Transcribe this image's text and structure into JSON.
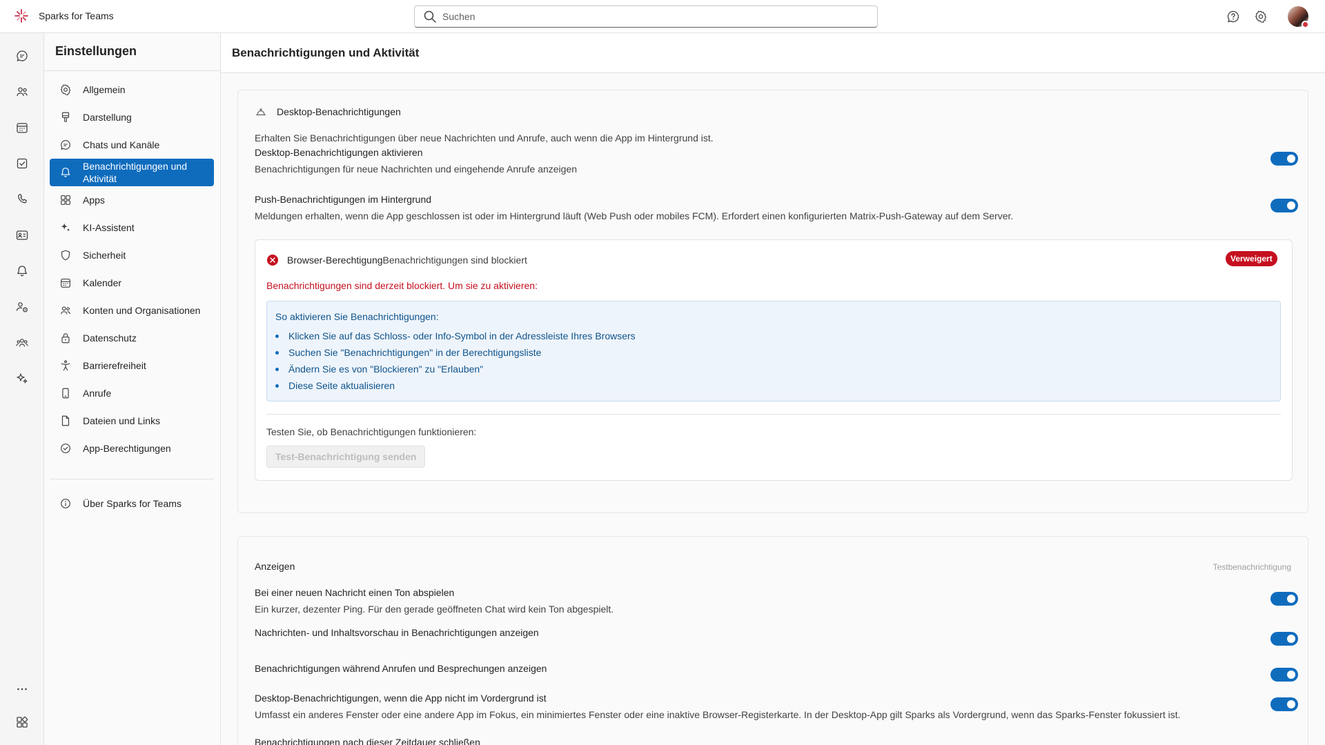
{
  "app": {
    "name": "Sparks for Teams"
  },
  "search": {
    "placeholder": "Suchen"
  },
  "colors": {
    "accent": "#0f6cbd",
    "error": "#c50f1f",
    "info_text": "#0f548c"
  },
  "topbar": {
    "icons": [
      "help-icon",
      "settings-icon",
      "avatar"
    ]
  },
  "rail": {
    "icons": [
      "chat-icon",
      "teams-icon",
      "calendar-icon",
      "tasks-icon",
      "calls-icon",
      "contacts-icon",
      "activity-icon",
      "people-icon",
      "communities-icon",
      "ai-icon",
      "more-icon",
      "apps-icon"
    ]
  },
  "sidebar": {
    "title": "Einstellungen",
    "items": [
      {
        "label": "Allgemein",
        "icon": "gear-icon"
      },
      {
        "label": "Darstellung",
        "icon": "paint-brush-icon"
      },
      {
        "label": "Chats und Kanäle",
        "icon": "chat-icon"
      },
      {
        "label": "Benachrichtigungen und Aktivität",
        "icon": "bell-icon"
      },
      {
        "label": "Apps",
        "icon": "apps-icon"
      },
      {
        "label": "KI-Assistent",
        "icon": "sparkle-icon"
      },
      {
        "label": "Sicherheit",
        "icon": "shield-icon"
      },
      {
        "label": "Kalender",
        "icon": "calendar-icon"
      },
      {
        "label": "Konten und Organisationen",
        "icon": "people-icon"
      },
      {
        "label": "Datenschutz",
        "icon": "lock-icon"
      },
      {
        "label": "Barrierefreiheit",
        "icon": "accessibility-icon"
      },
      {
        "label": "Anrufe",
        "icon": "phone-icon"
      },
      {
        "label": "Dateien und Links",
        "icon": "document-icon"
      },
      {
        "label": "App-Berechtigungen",
        "icon": "check-circle-icon"
      }
    ],
    "active_index": 3,
    "about": {
      "label": "Über Sparks for Teams",
      "icon": "info-icon"
    }
  },
  "main": {
    "title": "Benachrichtigungen und Aktivität",
    "desktop": {
      "heading": "Desktop-Benachrichtigungen",
      "intro": "Erhalten Sie Benachrichtigungen über neue Nachrichten und Anrufe, auch wenn die App im Hintergrund ist.",
      "enable": {
        "label": "Desktop-Benachrichtigungen aktivieren",
        "desc": "Benachrichtigungen für neue Nachrichten und eingehende Anrufe anzeigen",
        "on": true
      },
      "push": {
        "label": "Push-Benachrichtigungen im Hintergrund",
        "desc": "Meldungen erhalten, wenn die App geschlossen ist oder im Hintergrund läuft (Web Push oder mobiles FCM). Erfordert einen konfigurierten Matrix-Push-Gateway auf dem Server.",
        "on": true
      },
      "permission": {
        "title": "Browser-Berechtigung",
        "status": "Benachrichtigungen sind blockiert",
        "badge": "Verweigert",
        "error": "Benachrichtigungen sind derzeit blockiert. Um sie zu aktivieren:",
        "how_title": "So aktivieren Sie Benachrichtigungen:",
        "steps": [
          "Klicken Sie auf das Schloss- oder Info-Symbol in der Adressleiste Ihres Browsers",
          "Suchen Sie \"Benachrichtigungen\" in der Berechtigungsliste",
          "Ändern Sie es von \"Blockieren\" zu \"Erlauben\"",
          "Diese Seite aktualisieren"
        ],
        "test_prompt": "Testen Sie, ob Benachrichtigungen funktionieren:",
        "test_button": "Test-Benachrichtigung senden"
      }
    },
    "display": {
      "heading": "Anzeigen",
      "test_link": "Testbenachrichtigung",
      "items": [
        {
          "label": "Bei einer neuen Nachricht einen Ton abspielen",
          "desc": "Ein kurzer, dezenter Ping. Für den gerade geöffneten Chat wird kein Ton abgespielt.",
          "on": true
        },
        {
          "label": "Nachrichten- und Inhaltsvorschau in Benachrichtigungen anzeigen",
          "on": true
        },
        {
          "label": "Benachrichtigungen während Anrufen und Besprechungen anzeigen",
          "on": true
        },
        {
          "label": "Desktop-Benachrichtigungen, wenn die App nicht im Vordergrund ist",
          "desc": "Umfasst ein anderes Fenster oder eine andere App im Fokus, ein minimiertes Fenster oder eine inaktive Browser-Registerkarte. In der Desktop-App gilt Sparks als Vordergrund, wenn das Sparks-Fenster fokussiert ist.",
          "on": true
        },
        {
          "label": "Benachrichtigungen nach dieser Zeitdauer schließen"
        }
      ]
    }
  }
}
